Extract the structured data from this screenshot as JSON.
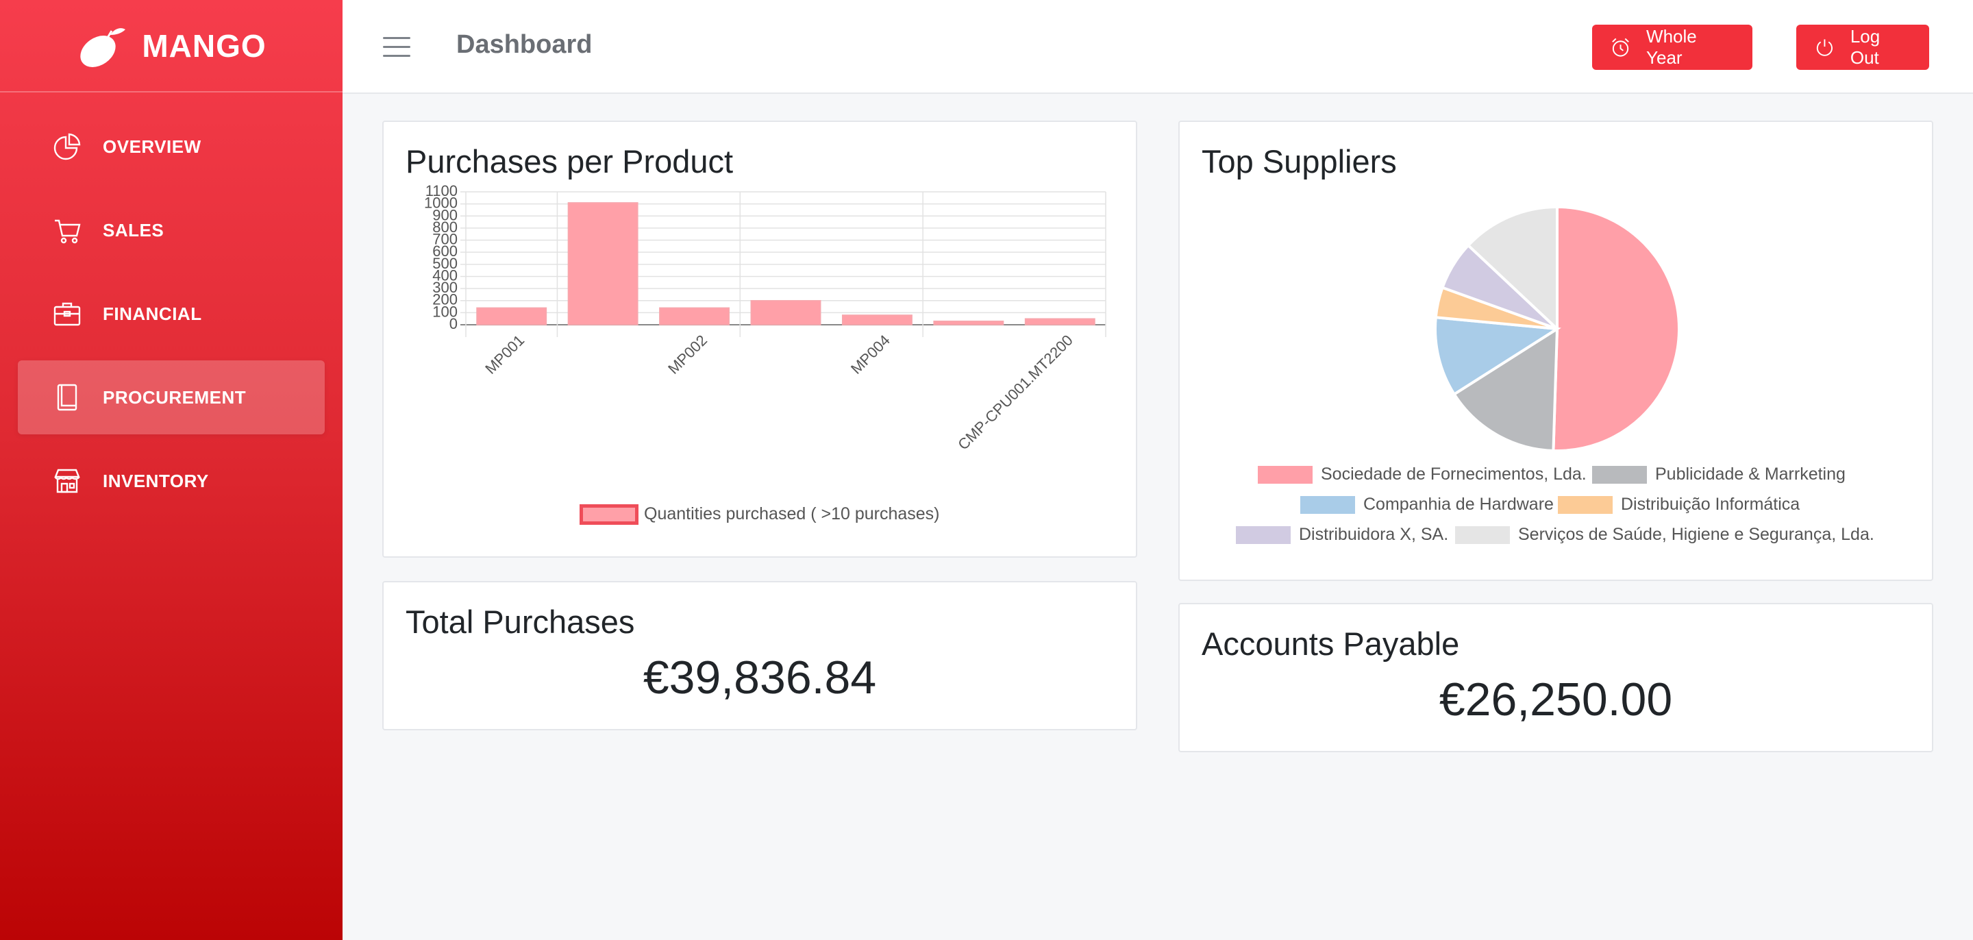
{
  "brand": {
    "name": "MANGO"
  },
  "sidebar": {
    "items": [
      {
        "label": "OVERVIEW",
        "icon": "pie-chart-icon"
      },
      {
        "label": "SALES",
        "icon": "cart-icon"
      },
      {
        "label": "FINANCIAL",
        "icon": "briefcase-icon"
      },
      {
        "label": "PROCUREMENT",
        "icon": "book-icon",
        "active": true
      },
      {
        "label": "INVENTORY",
        "icon": "store-icon"
      }
    ]
  },
  "header": {
    "title": "Dashboard",
    "year_button": "Whole Year",
    "logout_button": "Log Out"
  },
  "colors": {
    "accent": "#f2303b",
    "bar_fill": "#ffa0a8",
    "bar_border": "#ef4d59"
  },
  "cards": {
    "purchases_per_product": {
      "title": "Purchases per Product",
      "legend": "Quantities purchased ( >10 purchases)"
    },
    "top_suppliers": {
      "title": "Top Suppliers"
    },
    "total_purchases": {
      "title": "Total Purchases",
      "value": "€39,836.84"
    },
    "accounts_payable": {
      "title": "Accounts Payable",
      "value": "€26,250.00"
    }
  },
  "chart_data": [
    {
      "type": "bar",
      "title": "Purchases per Product",
      "categories": [
        "MP001",
        "",
        "MP002",
        "",
        "MP004",
        "",
        "CMP-CPU001.MT2200"
      ],
      "series": [
        {
          "name": "Quantities purchased ( >10 purchases)",
          "values": [
            140,
            1010,
            140,
            200,
            80,
            30,
            50
          ]
        }
      ],
      "yticks": [
        0,
        100,
        200,
        300,
        400,
        500,
        600,
        700,
        800,
        900,
        1000,
        1100
      ],
      "ylim": [
        0,
        1100
      ],
      "grid": true,
      "legend_position": "bottom"
    },
    {
      "type": "pie",
      "title": "Top Suppliers",
      "labels": [
        "Sociedade de Fornecimentos, Lda.",
        "Publicidade & Marrketing",
        "Companhia de Hardware",
        "Distribuição Informática",
        "Distribuidora X, SA.",
        "Serviços de Saúde, Higiene e Segurança, Lda."
      ],
      "values": [
        50.5,
        15.5,
        10.5,
        4,
        6.5,
        13
      ],
      "colors": [
        "#ff9fa8",
        "#b8babd",
        "#a9cce8",
        "#fccb96",
        "#d1cbe2",
        "#e5e5e5"
      ],
      "legend_position": "bottom"
    }
  ]
}
